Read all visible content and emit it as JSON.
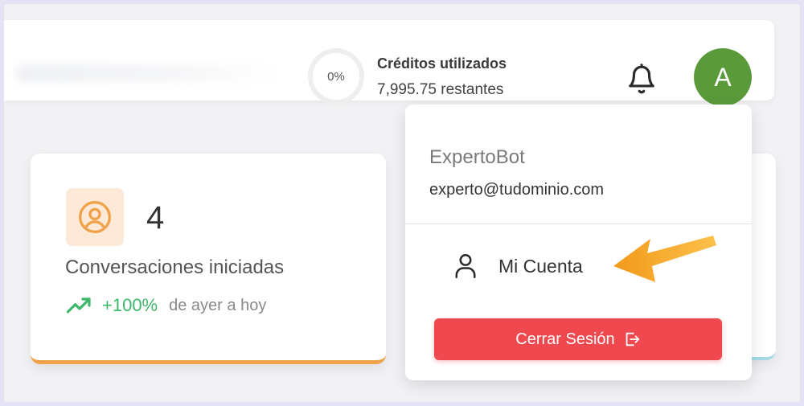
{
  "header": {
    "credits": {
      "percent_label": "0%",
      "percent_value": 0,
      "title": "Créditos utilizados",
      "remaining": "7,995.75 restantes"
    },
    "notifications_icon": "bell-icon",
    "user_avatar_initial": "A",
    "avatar_color": "#5a9a3a"
  },
  "stat_card": {
    "icon": "user-circle-icon",
    "value": "4",
    "label": "Conversaciones iniciadas",
    "trend": {
      "icon": "trending-up-icon",
      "percent": "+100%",
      "period": "de ayer a hoy"
    },
    "accent_color": "#f0a24a"
  },
  "user_menu": {
    "name": "ExpertoBot",
    "email": "experto@tudominio.com",
    "items": [
      {
        "icon": "user-icon",
        "label": "Mi Cuenta"
      }
    ],
    "logout": {
      "label": "Cerrar Sesión",
      "icon": "logout-icon",
      "color": "#f0484f"
    }
  },
  "annotation": {
    "icon": "arrow-icon",
    "color": "#f5a623"
  }
}
